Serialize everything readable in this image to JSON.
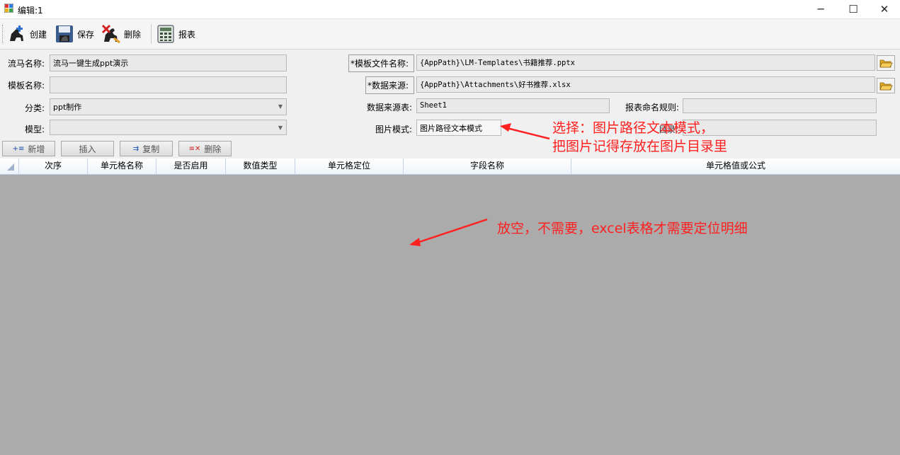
{
  "window": {
    "title": "编辑:1",
    "min": "─",
    "max": "☐",
    "close": "✕"
  },
  "toolbar": {
    "create_label": "创建",
    "save_label": "保存",
    "delete_label": "删除",
    "report_label": "报表"
  },
  "form": {
    "flow_name_label": "流马名称:",
    "flow_name_value": "流马一键生成ppt演示",
    "template_name_label": "模板名称:",
    "template_name_value": "",
    "category_label": "分类:",
    "category_value": "ppt制作",
    "model_label": "模型:",
    "model_value": "",
    "template_file_label": "*模板文件名称:",
    "template_file_value": "{AppPath}\\LM-Templates\\书籍推荐.pptx",
    "data_source_label": "*数据来源:",
    "data_source_value": "{AppPath}\\Attachments\\好书推荐.xlsx",
    "data_sheet_label": "数据来源表:",
    "data_sheet_value": "Sheet1",
    "report_naming_label": "报表命名规则:",
    "report_naming_value": "",
    "image_mode_label": "图片模式:",
    "image_mode_value": "图片路径文本模式",
    "hidden_label": "目录:"
  },
  "row_buttons": {
    "add_label": "新增",
    "insert_label": "插入",
    "copy_label": "复制",
    "delete_label": "删除"
  },
  "grid": {
    "columns": [
      "次序",
      "单元格名称",
      "是否启用",
      "数值类型",
      "单元格定位",
      "字段名称",
      "单元格值或公式"
    ]
  },
  "annotations": {
    "note1_line1": "选择：图片路径文本模式，",
    "note1_line2": "把图片记得存放在图片目录里",
    "note2": "放空，不需要，excel表格才需要定位明细"
  },
  "colors": {
    "annotation": "#ff2020",
    "grid_body": "#ababab"
  }
}
